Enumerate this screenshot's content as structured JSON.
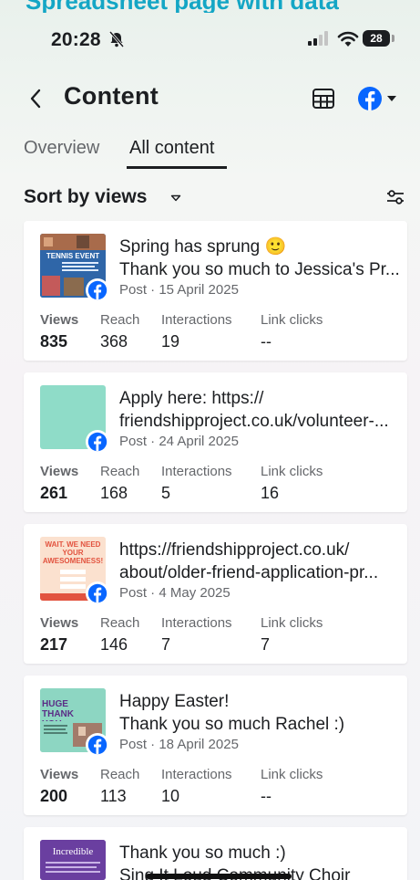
{
  "top_cut_text": "Spreadsheet page with data",
  "status": {
    "time": "20:28",
    "battery": "28"
  },
  "header": {
    "title": "Content"
  },
  "tabs": [
    {
      "label": "Overview",
      "active": false
    },
    {
      "label": "All content",
      "active": true
    }
  ],
  "sort": {
    "label": "Sort by views"
  },
  "metric_labels": [
    "Views",
    "Reach",
    "Interactions",
    "Link clicks"
  ],
  "posts": [
    {
      "line1": "Spring has sprung 🙂",
      "line2": "Thank you so much to Jessica's Pr...",
      "meta": "Post · 15 April 2025",
      "thumb_title": "TENNIS EVENT",
      "metrics": [
        "835",
        "368",
        "19",
        "--"
      ]
    },
    {
      "line1": "Apply here: https://",
      "line2": "friendshipproject.co.uk/volunteer-...",
      "meta": "Post · 24 April 2025",
      "thumb_title": "",
      "metrics": [
        "261",
        "168",
        "5",
        "16"
      ]
    },
    {
      "line1": "https://friendshipproject.co.uk/",
      "line2": "about/older-friend-application-pr...",
      "meta": "Post · 4 May 2025",
      "thumb_title": "WAIT. WE NEED YOUR AWESOMENESS!",
      "metrics": [
        "217",
        "146",
        "7",
        "7"
      ]
    },
    {
      "line1": "Happy Easter!",
      "line2": "Thank you so much Rachel :)",
      "meta": "Post · 18 April 2025",
      "thumb_title": "HUGE THANK YOU",
      "metrics": [
        "200",
        "113",
        "10",
        "--"
      ]
    },
    {
      "line1": "Thank you so much :)",
      "line2": "Sing It Loud Community Choir",
      "meta": "",
      "thumb_title": "Incredible",
      "metrics": []
    }
  ],
  "colors": {
    "facebook_blue": "#0866ff",
    "text_primary": "#1c1e21",
    "text_secondary": "#65676b"
  },
  "icons": [
    "bell-muted-icon",
    "signal-icon",
    "wifi-icon",
    "battery-icon",
    "back-arrow-icon",
    "table-icon",
    "facebook-icon",
    "chevron-down-icon",
    "filter-sliders-icon"
  ]
}
